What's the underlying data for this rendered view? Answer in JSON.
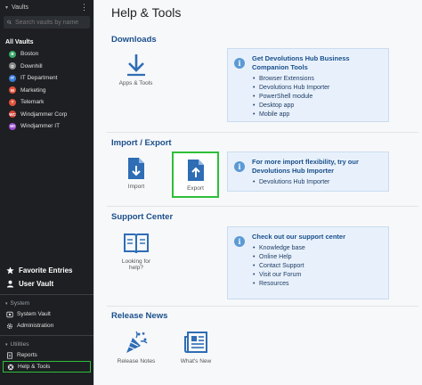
{
  "sidebar": {
    "header_label": "Vaults",
    "search_placeholder": "Search vaults by name",
    "section_title": "All Vaults",
    "vaults": [
      {
        "label": "Boston",
        "initial": "B",
        "color": "#3aa86b"
      },
      {
        "label": "Downhill",
        "initial": "D",
        "color": "#8a8a8a"
      },
      {
        "label": "IT Department",
        "initial": "IT",
        "color": "#3a7bd5"
      },
      {
        "label": "Marketing",
        "initial": "M",
        "color": "#e0533d"
      },
      {
        "label": "Telemark",
        "initial": "T",
        "color": "#e0533d"
      },
      {
        "label": "Windjammer Corp",
        "initial": "WC",
        "color": "#d8453b"
      },
      {
        "label": "Windjammer IT",
        "initial": "WI",
        "color": "#9b4fd1"
      }
    ],
    "favorite_entries": "Favorite Entries",
    "user_vault": "User Vault",
    "system_group": "System",
    "system_vault": "System Vault",
    "administration": "Administration",
    "utilities_group": "Utilities",
    "reports": "Reports",
    "help_tools": "Help & Tools"
  },
  "main": {
    "title": "Help & Tools",
    "downloads": {
      "title": "Downloads",
      "tile_label": "Apps & Tools",
      "info_title": "Get Devolutions Hub Business Companion Tools",
      "info_items": [
        "Browser Extensions",
        "Devolutions Hub Importer",
        "PowerShell module",
        "Desktop app",
        "Mobile app"
      ]
    },
    "import_export": {
      "title": "Import / Export",
      "import_label": "Import",
      "export_label": "Export",
      "info_title": "For more import flexibility, try our Devolutions Hub Importer",
      "info_items": [
        "Devolutions Hub Importer"
      ]
    },
    "support": {
      "title": "Support Center",
      "tile_label_line1": "Looking for",
      "tile_label_line2": "help?",
      "info_title": "Check out our support center",
      "info_items": [
        "Knowledge base",
        "Online Help",
        "Contact Support",
        "Visit our Forum",
        "Resources"
      ]
    },
    "release": {
      "title": "Release News",
      "notes_label": "Release Notes",
      "whats_new_label": "What's New"
    }
  },
  "colors": {
    "accent_blue": "#1a4f8b",
    "icon_blue": "#2f6db5",
    "highlight_green": "#2fbf3a",
    "sidebar_bg": "#1d1f22"
  }
}
